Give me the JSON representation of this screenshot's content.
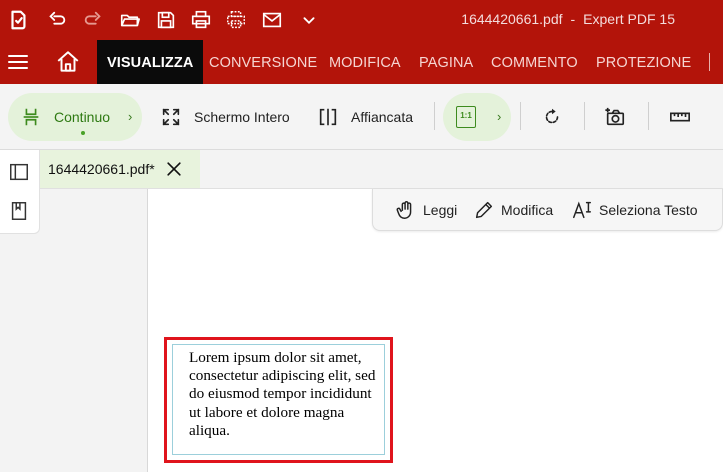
{
  "titlebar": {
    "filename": "1644420661.pdf",
    "separator": "-",
    "app_name": "Expert PDF 15"
  },
  "tabs": [
    {
      "label": "VISUALIZZA",
      "active": true
    },
    {
      "label": "CONVERSIONE"
    },
    {
      "label": "MODIFICA"
    },
    {
      "label": "PAGINA"
    },
    {
      "label": "COMMENTO"
    },
    {
      "label": "PROTEZIONE"
    }
  ],
  "toolbar": {
    "continuo": "Continuo",
    "schermo_intero": "Schermo Intero",
    "affiancata": "Affiancata",
    "chevron": "›",
    "actual_size_glyph": "1:1"
  },
  "document_tab": {
    "label": "1644420661.pdf*"
  },
  "modes": {
    "leggi": "Leggi",
    "modifica": "Modifica",
    "seleziona_testo": "Seleziona Testo"
  },
  "textbox": {
    "content": "Lorem ipsum dolor sit amet, consectetur adipiscing elit, sed do eiusmod tempor incididunt ut labore et dolore magna aliqua."
  },
  "colors": {
    "brand_red": "#b3140a",
    "active_tab": "#0b0b0b",
    "accent_green": "#4aa228",
    "pill_green": "#e4f2da",
    "selection_red": "#e0141c"
  }
}
